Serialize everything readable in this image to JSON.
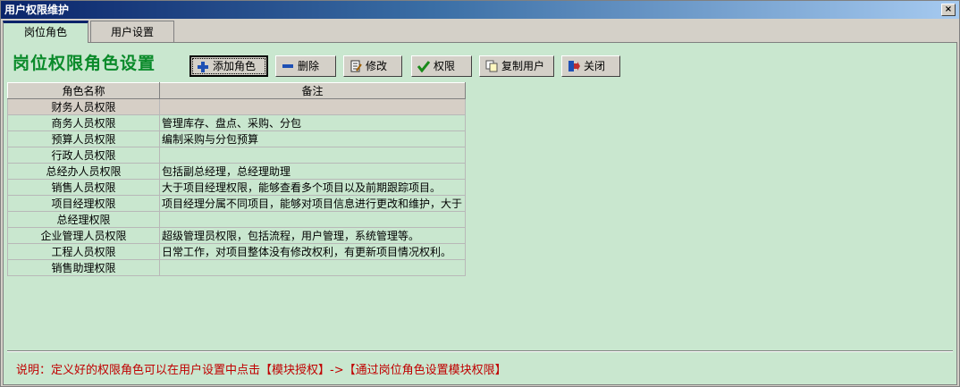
{
  "window": {
    "title": "用户权限维护",
    "close_label": "×"
  },
  "tabs": [
    {
      "label": "岗位角色"
    },
    {
      "label": "用户设置"
    }
  ],
  "panel": {
    "heading": "岗位权限角色设置",
    "toolbar": {
      "add_label": "添加角色",
      "delete_label": "删除",
      "edit_label": "修改",
      "permission_label": "权限",
      "copy_user_label": "复制用户",
      "close_label": "关闭"
    },
    "table": {
      "columns": [
        "角色名称",
        "备注"
      ],
      "rows": [
        {
          "name": "财务人员权限",
          "note": ""
        },
        {
          "name": "商务人员权限",
          "note": "管理库存、盘点、采购、分包"
        },
        {
          "name": "预算人员权限",
          "note": "编制采购与分包预算"
        },
        {
          "name": "行政人员权限",
          "note": ""
        },
        {
          "name": "总经办人员权限",
          "note": "包括副总经理，总经理助理"
        },
        {
          "name": "销售人员权限",
          "note": "大于项目经理权限，能够查看多个项目以及前期跟踪项目。"
        },
        {
          "name": "项目经理权限",
          "note": "项目经理分属不同项目，能够对项目信息进行更改和维护，大于"
        },
        {
          "name": "总经理权限",
          "note": ""
        },
        {
          "name": "企业管理人员权限",
          "note": "超级管理员权限，包括流程，用户管理，系统管理等。"
        },
        {
          "name": "工程人员权限",
          "note": "日常工作，对项目整体没有修改权利，有更新项目情况权利。"
        },
        {
          "name": "销售助理权限",
          "note": ""
        }
      ]
    },
    "footer": "说明：定义好的权限角色可以在用户设置中点击【模块授权】->【通过岗位角色设置模块权限】"
  },
  "colors": {
    "panel_bg": "#c9e7cf",
    "heading": "#0a8a2a",
    "footer_text": "#c00000",
    "titlebar": "#0a246a"
  }
}
